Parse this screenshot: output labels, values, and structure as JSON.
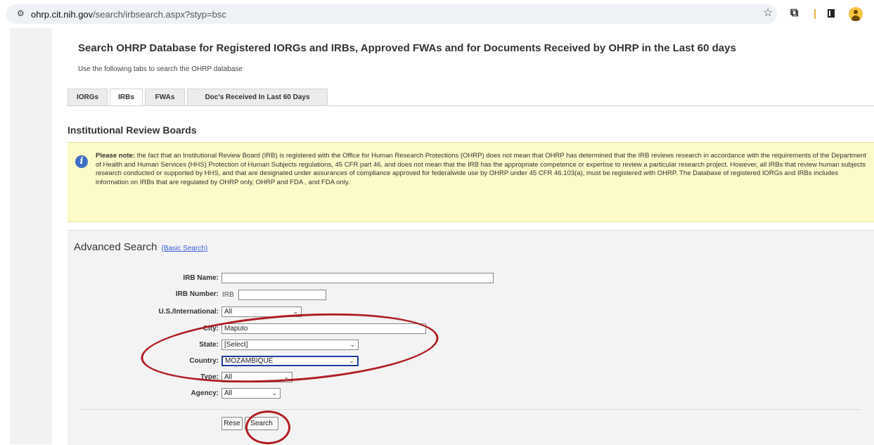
{
  "browser": {
    "url_host": "ohrp.cit.nih.gov",
    "url_path": "/search/irbsearch.aspx?styp=bsc",
    "icons": [
      "site-settings-icon",
      "bookmark-star-icon",
      "extensions-icon",
      "side-panel-icon",
      "profile-icon"
    ],
    "accent": "#e8b13a"
  },
  "page": {
    "title": "Search OHRP Database for Registered IORGs and IRBs, Approved FWAs and for Documents Received by OHRP in the Last 60 days",
    "instructions": "Use the following tabs to search the OHRP database",
    "tabs": [
      {
        "label": "IORGs",
        "active": false
      },
      {
        "label": "IRBs",
        "active": true
      },
      {
        "label": "FWAs",
        "active": false
      },
      {
        "label": "Doc's Received In Last 60 Days",
        "active": false
      }
    ],
    "section_title": "Institutional Review Boards"
  },
  "notice": {
    "lead": "Please note:",
    "text": " the fact that an Institutional Review Board (IRB) is registered with the Office for Human Research Protections (OHRP) does not mean that OHRP has determined that the IRB reviews research in accordance with the requirements of the Department of Health and Human Services (HHS) Protection of Human Subjects regulations, 45 CFR part 46, and does not mean that the IRB has the appropriate competence or expertise to review a particular research project.  However, all IRBs that review human subjects research conducted or supported by HHS, and that are designated under assurances of compliance approved for federalwide use by OHRP under 45 CFR 46.103(a), must be registered with OHRP.  The Database of registered IORGs and IRBs includes information on IRBs that are regulated by OHRP only, OHRP and FDA , and FDA only.",
    "background": "#fbfac8"
  },
  "search": {
    "title": "Advanced Search",
    "basic_link": "(Basic Search)",
    "fields": {
      "irb_name_label": "IRB Name:",
      "irb_name_value": "",
      "irb_number_label": "IRB Number:",
      "irb_number_prefix": "IRB",
      "irb_number_value": "",
      "us_intl_label": "U.S./International:",
      "us_intl_value": "All",
      "city_label": "City:",
      "city_value": "Maputo",
      "state_label": "State:",
      "state_value": "[Select]",
      "country_label": "Country:",
      "country_value": "MOZAMBIQUE",
      "type_label": "Type:",
      "type_value": "All",
      "agency_label": "Agency:",
      "agency_value": "All"
    },
    "reset_label": "Rese",
    "search_label": "Search"
  },
  "annotation_color": "#b01e24"
}
